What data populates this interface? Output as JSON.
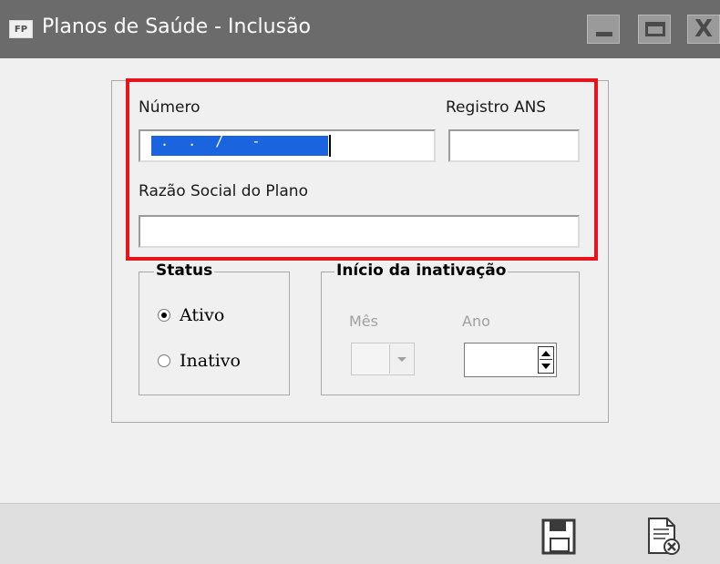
{
  "window": {
    "app_icon_text": "FP",
    "title": "Planos de Saúde - Inclusão"
  },
  "form": {
    "numero_label": "Número",
    "numero_mask": " .  .  /   - ",
    "registro_label": "Registro ANS",
    "registro_value": "",
    "razao_label": "Razão Social do Plano",
    "razao_value": ""
  },
  "status": {
    "legend": "Status",
    "options": [
      {
        "label": "Ativo",
        "checked": true
      },
      {
        "label": "Inativo",
        "checked": false
      }
    ]
  },
  "inativacao": {
    "legend": "Início da inativação",
    "mes_label": "Mês",
    "mes_value": "",
    "ano_label": "Ano",
    "ano_value": ""
  },
  "toolbar": {
    "icons": [
      "save-icon",
      "cancel-document-icon"
    ]
  },
  "colors": {
    "titlebar": "#6b6b6b",
    "highlight": "#e8141b",
    "selection": "#1a64e0"
  }
}
